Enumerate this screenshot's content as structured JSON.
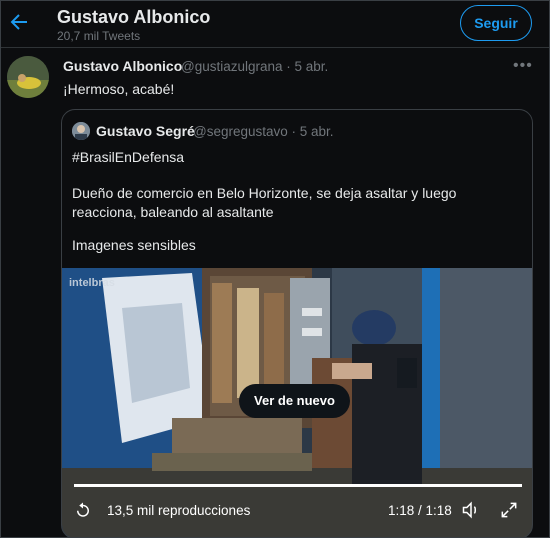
{
  "header": {
    "title": "Gustavo Albonico",
    "tweet_count": "20,7 mil Tweets",
    "follow_label": "Seguir"
  },
  "tweet": {
    "name": "Gustavo Albonico",
    "handle_date": "@gustiazulgrana · 5 abr.",
    "text": "¡Hermoso, acabé!"
  },
  "quote": {
    "name": "Gustavo Segré",
    "handle_date": "@segregustavo · 5 abr.",
    "hashtag": "#BrasilEnDefensa",
    "body": "Dueño de comercio en Belo Horizonte, se deja asaltar y luego reacciona, baleando al asaltante",
    "note": "Imagenes sensibles"
  },
  "video": {
    "watermark": "intelbras",
    "replay_label": "Ver de nuevo",
    "views": "13,5 mil reproducciones",
    "time": "1:18 / 1:18",
    "progress": 1.0
  },
  "colors": {
    "accent": "#1d9bf0",
    "background": "#0c0d0f",
    "text": "#e7e9ea",
    "muted": "#71767b"
  }
}
